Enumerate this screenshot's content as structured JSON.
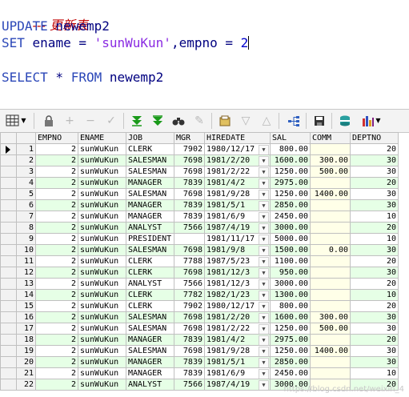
{
  "editor": {
    "comment": "--- 更新表",
    "update_kw": "UPDATE",
    "update_table": " newemp2",
    "set_kw": "SET",
    "set_lhs": " ename = ",
    "set_str": "'sunWuKun'",
    "set_mid": ",empno = ",
    "set_num": "2",
    "select_kw": "SELECT",
    "select_star": " * ",
    "from_kw": "FROM",
    "select_table": " newemp2"
  },
  "toolbar": {
    "icons": [
      "grid-view-icon",
      "lock-icon",
      "add-row-icon",
      "delete-row-icon",
      "post-icon",
      "first-record-icon",
      "last-record-icon",
      "find-icon",
      "clear-icon",
      "query-by-example-icon",
      "filter-down-icon",
      "filter-up-icon",
      "tree-icon",
      "save-icon",
      "export-icon",
      "chart-icon"
    ]
  },
  "grid": {
    "columns": [
      "EMPNO",
      "ENAME",
      "JOB",
      "MGR",
      "HIREDATE",
      "SAL",
      "COMM",
      "DEPTNO"
    ],
    "rows": [
      {
        "n": "1",
        "empno": "2",
        "ename": "sunWuKun",
        "job": "CLERK",
        "mgr": "7902",
        "hiredate": "1980/12/17",
        "sal": "800.00",
        "comm": "",
        "deptno": "20"
      },
      {
        "n": "2",
        "empno": "2",
        "ename": "sunWuKun",
        "job": "SALESMAN",
        "mgr": "7698",
        "hiredate": "1981/2/20",
        "sal": "1600.00",
        "comm": "300.00",
        "deptno": "30"
      },
      {
        "n": "3",
        "empno": "2",
        "ename": "sunWuKun",
        "job": "SALESMAN",
        "mgr": "7698",
        "hiredate": "1981/2/22",
        "sal": "1250.00",
        "comm": "500.00",
        "deptno": "30"
      },
      {
        "n": "4",
        "empno": "2",
        "ename": "sunWuKun",
        "job": "MANAGER",
        "mgr": "7839",
        "hiredate": "1981/4/2",
        "sal": "2975.00",
        "comm": "",
        "deptno": "20"
      },
      {
        "n": "5",
        "empno": "2",
        "ename": "sunWuKun",
        "job": "SALESMAN",
        "mgr": "7698",
        "hiredate": "1981/9/28",
        "sal": "1250.00",
        "comm": "1400.00",
        "deptno": "30"
      },
      {
        "n": "6",
        "empno": "2",
        "ename": "sunWuKun",
        "job": "MANAGER",
        "mgr": "7839",
        "hiredate": "1981/5/1",
        "sal": "2850.00",
        "comm": "",
        "deptno": "30"
      },
      {
        "n": "7",
        "empno": "2",
        "ename": "sunWuKun",
        "job": "MANAGER",
        "mgr": "7839",
        "hiredate": "1981/6/9",
        "sal": "2450.00",
        "comm": "",
        "deptno": "10"
      },
      {
        "n": "8",
        "empno": "2",
        "ename": "sunWuKun",
        "job": "ANALYST",
        "mgr": "7566",
        "hiredate": "1987/4/19",
        "sal": "3000.00",
        "comm": "",
        "deptno": "20"
      },
      {
        "n": "9",
        "empno": "2",
        "ename": "sunWuKun",
        "job": "PRESIDENT",
        "mgr": "",
        "hiredate": "1981/11/17",
        "sal": "5000.00",
        "comm": "",
        "deptno": "10"
      },
      {
        "n": "10",
        "empno": "2",
        "ename": "sunWuKun",
        "job": "SALESMAN",
        "mgr": "7698",
        "hiredate": "1981/9/8",
        "sal": "1500.00",
        "comm": "0.00",
        "deptno": "30"
      },
      {
        "n": "11",
        "empno": "2",
        "ename": "sunWuKun",
        "job": "CLERK",
        "mgr": "7788",
        "hiredate": "1987/5/23",
        "sal": "1100.00",
        "comm": "",
        "deptno": "20"
      },
      {
        "n": "12",
        "empno": "2",
        "ename": "sunWuKun",
        "job": "CLERK",
        "mgr": "7698",
        "hiredate": "1981/12/3",
        "sal": "950.00",
        "comm": "",
        "deptno": "30"
      },
      {
        "n": "13",
        "empno": "2",
        "ename": "sunWuKun",
        "job": "ANALYST",
        "mgr": "7566",
        "hiredate": "1981/12/3",
        "sal": "3000.00",
        "comm": "",
        "deptno": "20"
      },
      {
        "n": "14",
        "empno": "2",
        "ename": "sunWuKun",
        "job": "CLERK",
        "mgr": "7782",
        "hiredate": "1982/1/23",
        "sal": "1300.00",
        "comm": "",
        "deptno": "10"
      },
      {
        "n": "15",
        "empno": "2",
        "ename": "sunWuKun",
        "job": "CLERK",
        "mgr": "7902",
        "hiredate": "1980/12/17",
        "sal": "800.00",
        "comm": "",
        "deptno": "20"
      },
      {
        "n": "16",
        "empno": "2",
        "ename": "sunWuKun",
        "job": "SALESMAN",
        "mgr": "7698",
        "hiredate": "1981/2/20",
        "sal": "1600.00",
        "comm": "300.00",
        "deptno": "30"
      },
      {
        "n": "17",
        "empno": "2",
        "ename": "sunWuKun",
        "job": "SALESMAN",
        "mgr": "7698",
        "hiredate": "1981/2/22",
        "sal": "1250.00",
        "comm": "500.00",
        "deptno": "30"
      },
      {
        "n": "18",
        "empno": "2",
        "ename": "sunWuKun",
        "job": "MANAGER",
        "mgr": "7839",
        "hiredate": "1981/4/2",
        "sal": "2975.00",
        "comm": "",
        "deptno": "20"
      },
      {
        "n": "19",
        "empno": "2",
        "ename": "sunWuKun",
        "job": "SALESMAN",
        "mgr": "7698",
        "hiredate": "1981/9/28",
        "sal": "1250.00",
        "comm": "1400.00",
        "deptno": "30"
      },
      {
        "n": "20",
        "empno": "2",
        "ename": "sunWuKun",
        "job": "MANAGER",
        "mgr": "7839",
        "hiredate": "1981/5/1",
        "sal": "2850.00",
        "comm": "",
        "deptno": "30"
      },
      {
        "n": "21",
        "empno": "2",
        "ename": "sunWuKun",
        "job": "MANAGER",
        "mgr": "7839",
        "hiredate": "1981/6/9",
        "sal": "2450.00",
        "comm": "",
        "deptno": "10"
      },
      {
        "n": "22",
        "empno": "2",
        "ename": "sunWuKun",
        "job": "ANALYST",
        "mgr": "7566",
        "hiredate": "1987/4/19",
        "sal": "3000.00",
        "comm": "",
        "deptno": "20"
      }
    ]
  },
  "watermark": "https://blog.csdn.net/weixin_4"
}
